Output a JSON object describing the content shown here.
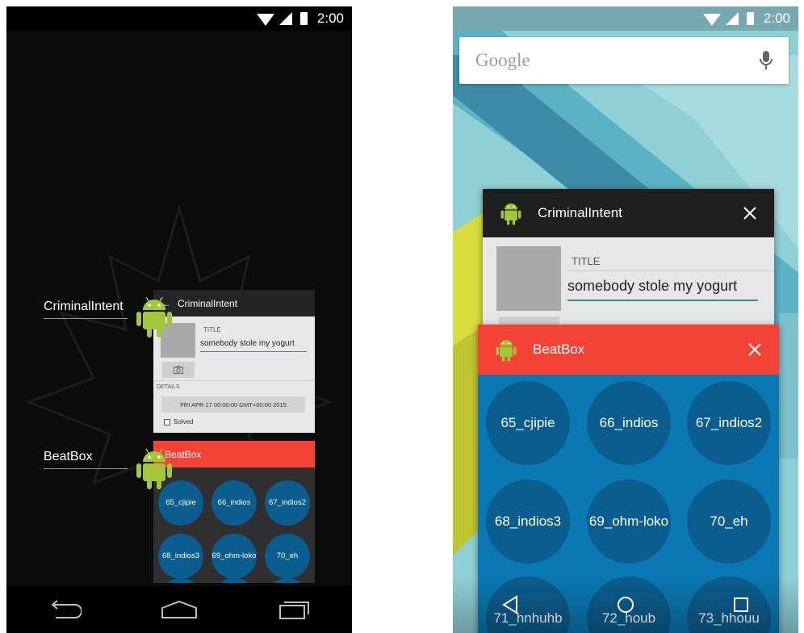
{
  "status_bar": {
    "time": "2:00"
  },
  "left_screen": {
    "apps": [
      {
        "label": "CriminalIntent"
      },
      {
        "label": "BeatBox"
      }
    ],
    "criminal_intent_preview": {
      "title": "CriminalIntent",
      "field_label": "TITLE",
      "field_value": "somebody stole my yogurt",
      "details_label": "DETAILS",
      "date": "FRI APR 17 00:00:00 GMT+00:00 2015",
      "solved_label": "Solved"
    },
    "beatbox_preview": {
      "title": "BeatBox",
      "sounds": [
        "65_cjipie",
        "66_indios",
        "67_indios2",
        "68_indios3",
        "69_ohm-loko",
        "70_eh"
      ]
    }
  },
  "right_screen": {
    "search": {
      "label": "Google"
    },
    "criminal_intent_card": {
      "title": "CriminalIntent",
      "field_label": "TITLE",
      "field_value": "somebody stole my yogurt"
    },
    "beatbox_card": {
      "title": "BeatBox",
      "sounds": [
        "65_cjipie",
        "66_indios",
        "67_indios2",
        "68_indios3",
        "69_ohm-loko",
        "70_eh",
        "71_hnhuhb",
        "72_houb",
        "73_hhouu"
      ]
    }
  },
  "colors": {
    "beatbox_red": "#f44336",
    "beatbox_blue": "#0a78b2",
    "sound_button": "#0b5d8f",
    "dark_bar": "#1e1e1e",
    "teal_underline": "#3b8f8b"
  },
  "icons": [
    "android-icon",
    "wifi-icon",
    "cell-signal-icon",
    "battery-icon",
    "back-icon",
    "home-icon",
    "recents-icon",
    "mic-icon",
    "close-icon",
    "camera-icon",
    "back-arrow-icon"
  ]
}
